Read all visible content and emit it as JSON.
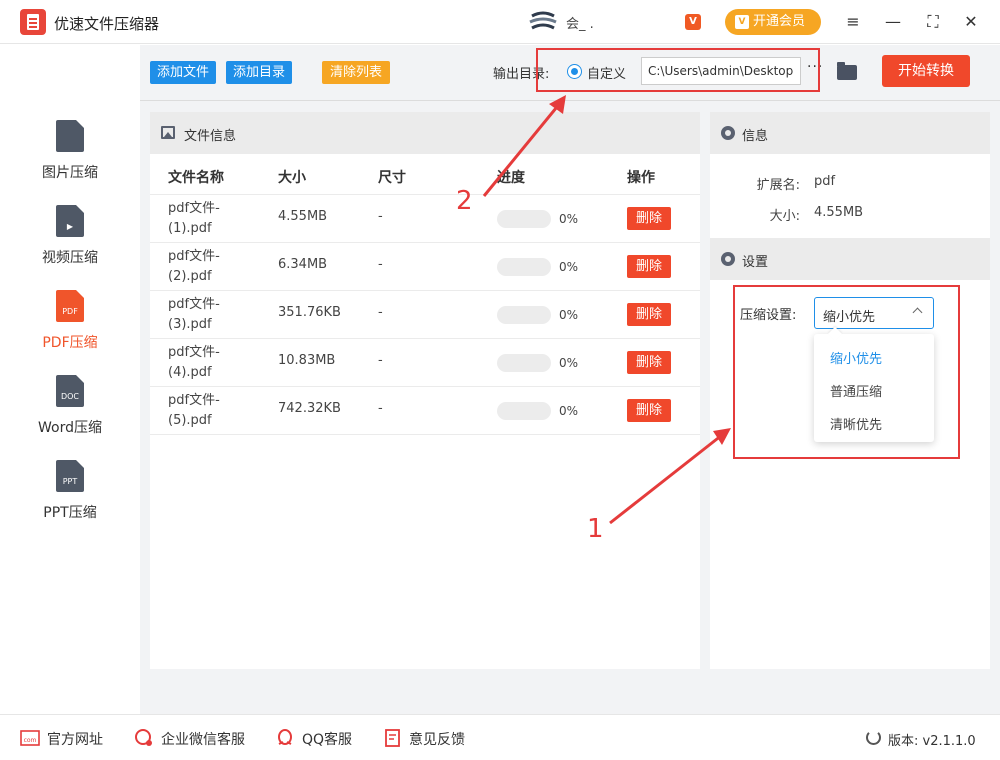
{
  "app": {
    "title": "优速文件压缩器",
    "user_name": "会_ .",
    "vip_label": "开通会员",
    "vip_icon": "V"
  },
  "toolbar": {
    "add_file": "添加文件",
    "add_folder": "添加目录",
    "clear_list": "清除列表",
    "output_label": "输出目录:",
    "radio_label": "自定义",
    "output_path": "C:\\Users\\admin\\Desktop",
    "more": "···",
    "start": "开始转换"
  },
  "sidebar": {
    "items": [
      {
        "label": "图片压缩",
        "icon": "image-file-icon",
        "badge": ""
      },
      {
        "label": "视频压缩",
        "icon": "video-file-icon",
        "badge": ""
      },
      {
        "label": "PDF压缩",
        "icon": "pdf-file-icon",
        "badge": "PDF",
        "active": true
      },
      {
        "label": "Word压缩",
        "icon": "doc-file-icon",
        "badge": "DOC"
      },
      {
        "label": "PPT压缩",
        "icon": "ppt-file-icon",
        "badge": "PPT"
      }
    ]
  },
  "file_panel": {
    "title": "文件信息",
    "columns": {
      "name": "文件名称",
      "size": "大小",
      "dim": "尺寸",
      "progress": "进度",
      "action": "操作"
    },
    "rows": [
      {
        "name": "pdf文件-(1).pdf",
        "size": "4.55MB",
        "dim": "-",
        "progress": 0,
        "progress_text": "0%",
        "action": "删除"
      },
      {
        "name": "pdf文件-(2).pdf",
        "size": "6.34MB",
        "dim": "-",
        "progress": 0,
        "progress_text": "0%",
        "action": "删除"
      },
      {
        "name": "pdf文件-(3).pdf",
        "size": "351.76KB",
        "dim": "-",
        "progress": 0,
        "progress_text": "0%",
        "action": "删除"
      },
      {
        "name": "pdf文件-(4).pdf",
        "size": "10.83MB",
        "dim": "-",
        "progress": 0,
        "progress_text": "0%",
        "action": "删除"
      },
      {
        "name": "pdf文件-(5).pdf",
        "size": "742.32KB",
        "dim": "-",
        "progress": 0,
        "progress_text": "0%",
        "action": "删除"
      }
    ]
  },
  "info_panel": {
    "title": "信息",
    "ext_label": "扩展名:",
    "ext_value": "pdf",
    "size_label": "大小:",
    "size_value": "4.55MB"
  },
  "settings_panel": {
    "title": "设置",
    "compress_label": "压缩设置:",
    "selected": "缩小优先",
    "options": [
      "缩小优先",
      "普通压缩",
      "清晰优先"
    ]
  },
  "annotations": {
    "marker_1": "1",
    "marker_2": "2",
    "color": "#e53b3b"
  },
  "footer": {
    "website": "官方网址",
    "wechat": "企业微信客服",
    "qq": "QQ客服",
    "feedback": "意见反馈",
    "version": "版本: v2.1.1.0"
  },
  "colors": {
    "accent_blue": "#1f8fe8",
    "accent_red": "#f0482b",
    "accent_orange": "#f6a623"
  }
}
